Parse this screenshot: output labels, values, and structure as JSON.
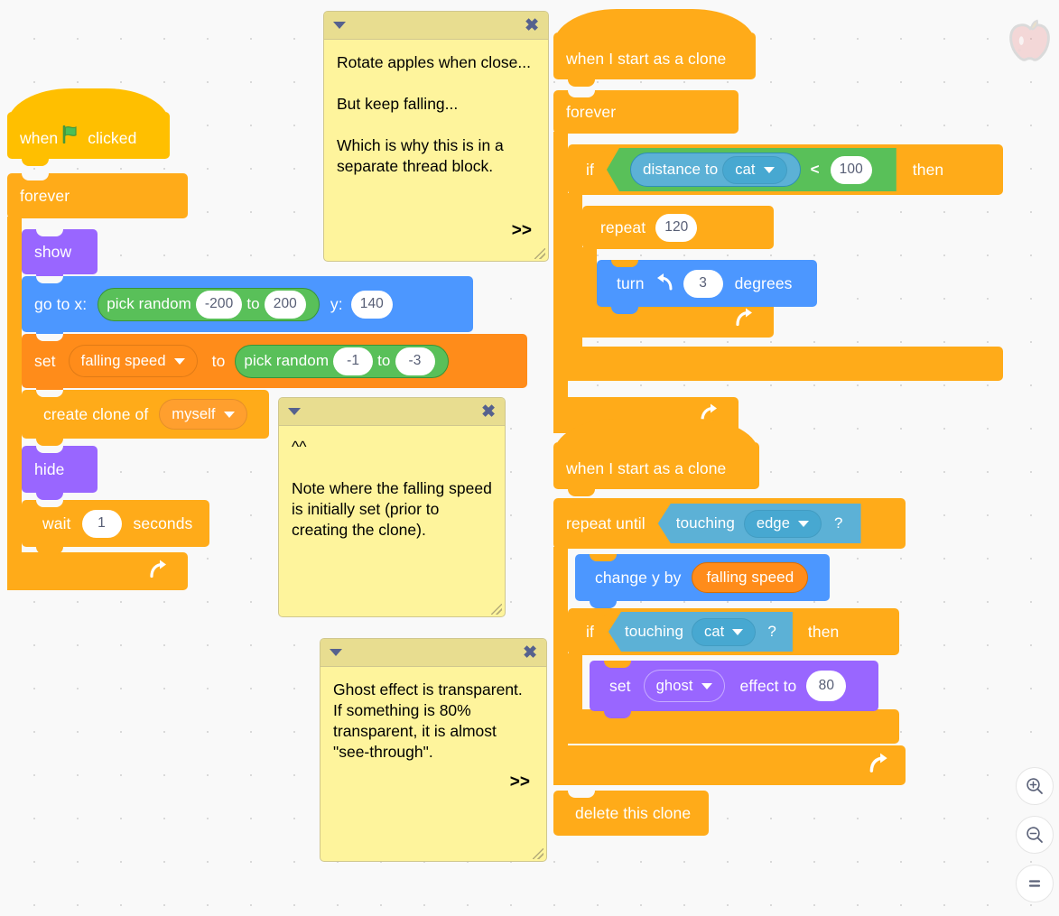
{
  "workspace": {
    "background_color": "#f9f9f9",
    "grid_dot_color": "#d9d9d9"
  },
  "watermark": {
    "name": "apple-sprite-watermark"
  },
  "zoom_controls": {
    "zoom_in_label": "+",
    "zoom_out_label": "−",
    "zoom_reset_label": "=",
    "items": [
      "zoom-in",
      "zoom-out",
      "zoom-reset"
    ]
  },
  "palette_colors": {
    "events": "#FFBF00",
    "control": "#FFAB19",
    "looks": "#9966FF",
    "motion": "#4C97FF",
    "variables": "#FF8C1A",
    "operators": "#59C059",
    "sensing": "#5CB1D6",
    "comment_body": "#FEF49C",
    "comment_header": "#E8DD90"
  },
  "scripts": {
    "main": {
      "hat": {
        "when": "when",
        "flag": "green-flag-icon",
        "clicked": "clicked"
      },
      "forever": "forever",
      "show": "show",
      "go_to": {
        "label_x": "go to x:",
        "label_y": "y:",
        "y_value": "140"
      },
      "pick_random_x": {
        "label": "pick random",
        "from": "-200",
        "to_label": "to",
        "to": "200"
      },
      "set_var": {
        "label": "set",
        "variable": "falling speed",
        "to_label": "to"
      },
      "pick_random_speed": {
        "label": "pick random",
        "from": "-1",
        "to_label": "to",
        "to": "-3"
      },
      "create_clone": {
        "label": "create clone of",
        "target": "myself"
      },
      "hide": "hide",
      "wait": {
        "label": "wait",
        "value": "1",
        "units": "seconds"
      }
    },
    "rotate_clone": {
      "hat": "when I start as a clone",
      "forever": "forever",
      "if_label": "if",
      "then_label": "then",
      "distance_to": {
        "label": "distance to",
        "target": "cat"
      },
      "operator": "<",
      "compare_value": "100",
      "repeat": {
        "label": "repeat",
        "value": "120"
      },
      "turn": {
        "label": "turn",
        "icon": "turn-counterclockwise-icon",
        "value": "3",
        "units": "degrees"
      }
    },
    "fall_clone": {
      "hat": "when I start as a clone",
      "repeat_until_label": "repeat until",
      "touching_edge": {
        "label": "touching",
        "target": "edge",
        "q": "?"
      },
      "change_y": {
        "label": "change y by",
        "variable": "falling speed"
      },
      "if_label": "if",
      "then_label": "then",
      "touching_cat": {
        "label": "touching",
        "target": "cat",
        "q": "?"
      },
      "set_effect": {
        "label": "set",
        "effect": "ghost",
        "mid_label": "effect to",
        "value": "80"
      },
      "delete_clone": "delete this clone"
    }
  },
  "comments": [
    {
      "id": "comment-rotate",
      "text": "Rotate apples when close...\n\nBut keep falling...\n\nWhich is why this is in a separate thread block.",
      "arrow": ">>",
      "collapse_icon": "collapse-triangle-icon",
      "close_icon": "close-icon"
    },
    {
      "id": "comment-falling-speed",
      "text": "^^\n\nNote where the falling speed is initially set (prior to creating the clone).",
      "arrow": "",
      "collapse_icon": "collapse-triangle-icon",
      "close_icon": "close-icon"
    },
    {
      "id": "comment-ghost",
      "text": "Ghost effect is transparent. If something is 80% transparent, it is almost \"see-through\".",
      "arrow": ">>",
      "collapse_icon": "collapse-triangle-icon",
      "close_icon": "close-icon"
    }
  ]
}
